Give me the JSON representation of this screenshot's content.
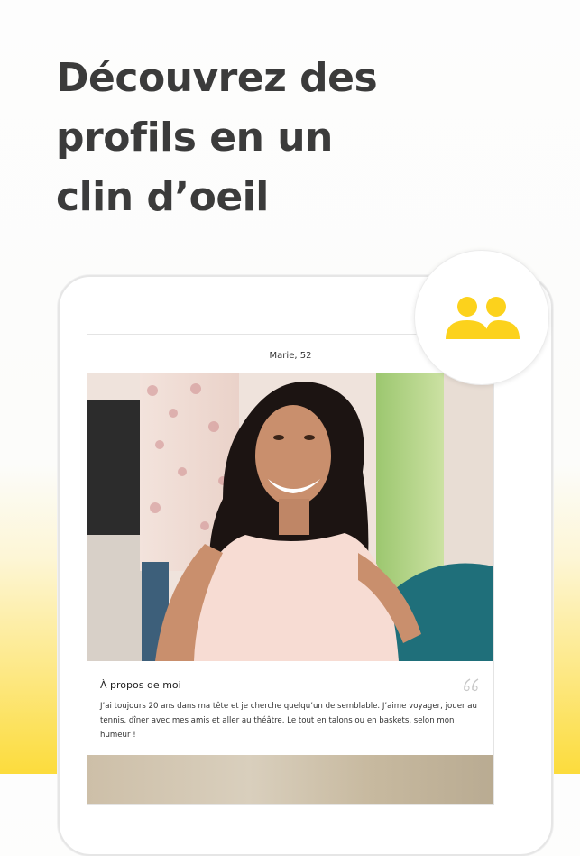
{
  "headline": {
    "line1": "Découvrez des",
    "line2": "profils en un",
    "line3": "clin d’oeil"
  },
  "profile": {
    "name_age": "Marie, 52",
    "about_title": "À propos de moi",
    "about_text": "J’ai toujours 20 ans dans ma tête et je cherche quelqu’un de semblable. J’aime voyager, jouer au tennis, dîner avec mes amis et aller au théâtre. Le tout en talons ou en baskets, selon mon humeur !"
  },
  "icons": {
    "badge": "users-icon",
    "quote": "quote-icon"
  },
  "colors": {
    "accent": "#fcd21c",
    "text_dark": "#3b3b3b"
  }
}
